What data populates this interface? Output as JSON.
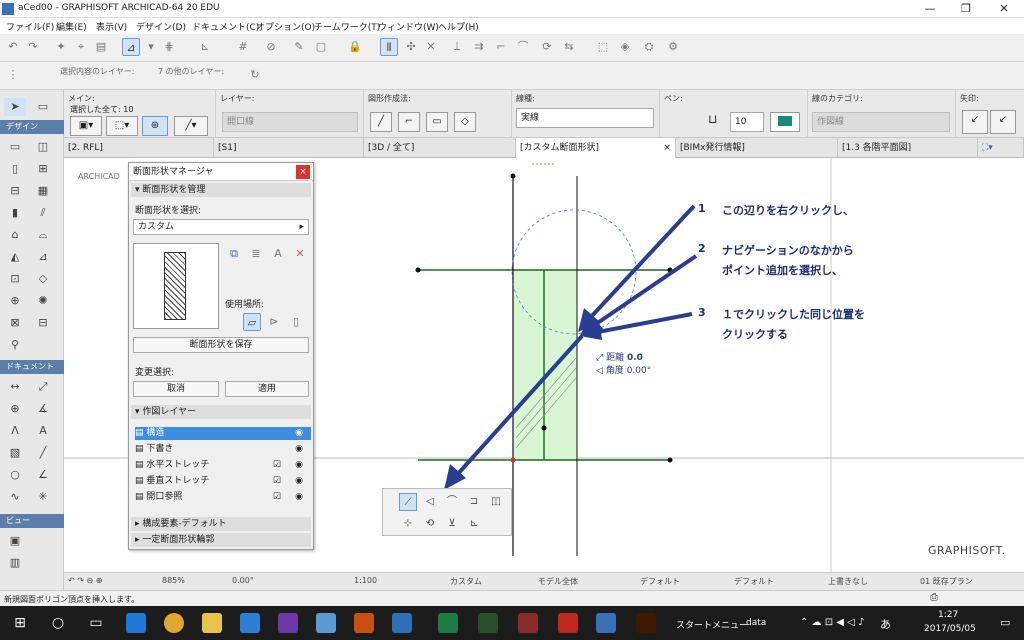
{
  "window": {
    "title": "aCed00 - GRAPHISOFT ARCHICAD-64 20 EDU",
    "min": "—",
    "max": "❐",
    "close": "✕"
  },
  "menu": [
    "ファイル(F)",
    "編集(E)",
    "表示(V)",
    "デザイン(D)",
    "ドキュメント(C)",
    "オプション(O)",
    "チームワーク(T)",
    "ウィンドウ(W)",
    "ヘルプ(H)"
  ],
  "toolbar2": {
    "label1": "選択内容のレイヤー:",
    "label2": "7 の他のレイヤー:"
  },
  "infobox": {
    "main_label": "メイン:",
    "selected_label": "選択した全て: 10",
    "layer_label": "レイヤー:",
    "layer_value": "開口線",
    "geometry_label": "図形作成法:",
    "line_type_label": "線種:",
    "line_type_value": "実線",
    "pen_label": "ペン:",
    "pen_value": "10",
    "category_label": "線のカテゴリ:",
    "category_value": "作図線",
    "arrow_label": "矢印:"
  },
  "toolbox": {
    "design": "デザイン",
    "document": "ドキュメント",
    "view": "ビュー"
  },
  "tabs": [
    "[2. RFL]",
    "[S1]",
    "[3D / 全て]",
    "[カスタム断面形状]",
    "[BIMx発行情報]",
    "[1.3 各階平面図]"
  ],
  "canvas": {
    "watermark": "ARCHICAD",
    "logo": "GRAPHISOFT."
  },
  "palette": {
    "title": "断面形状マネージャ",
    "close": "×",
    "section_manage": "断面形状を管理",
    "select_label": "断面形状を選択:",
    "select_value": "カスタム",
    "usage_label": "使用場所:",
    "save_button": "断面形状を保存",
    "edit_label": "変更選択:",
    "cancel_button": "取消",
    "apply_button": "適用",
    "section_layers": "作図レイヤー",
    "layers": [
      {
        "name": "構造",
        "checked": false
      },
      {
        "name": "下書き",
        "checked": false
      },
      {
        "name": "水平ストレッチ",
        "checked": true
      },
      {
        "name": "垂直ストレッチ",
        "checked": true
      },
      {
        "name": "開口参照",
        "checked": true
      }
    ],
    "section_defaults": "構成要素-デフォルト",
    "section_edge": "一定断面形状輪郭"
  },
  "annotations": [
    {
      "num": "1",
      "text": "この辺りを右クリックし、"
    },
    {
      "num": "2",
      "text": "ナビゲーションのなかから",
      "text2": "ポイント追加を選択し、"
    },
    {
      "num": "3",
      "text": "１でクリックした同じ位置を",
      "text2": "クリックする"
    }
  ],
  "tracker": {
    "distance_label": "距離",
    "distance_value": "0.0",
    "angle_label": "角度",
    "angle_value": "0.00°"
  },
  "status": {
    "zoom": "885%",
    "angle": "0.00°",
    "scale": "1:100",
    "layer_combo": "カスタム",
    "model": "モデル全体",
    "pen": "デフォルト",
    "override": "デフォルト",
    "renovation": "上書きなし",
    "filter": "01 既存プラン"
  },
  "hint": "新規図面ポリゴン頂点を挿入します。",
  "taskbar": {
    "start_menu": "スタートメニュー",
    "data": "data",
    "time": "1:27",
    "date": "2017/05/05",
    "ime": "あ"
  }
}
